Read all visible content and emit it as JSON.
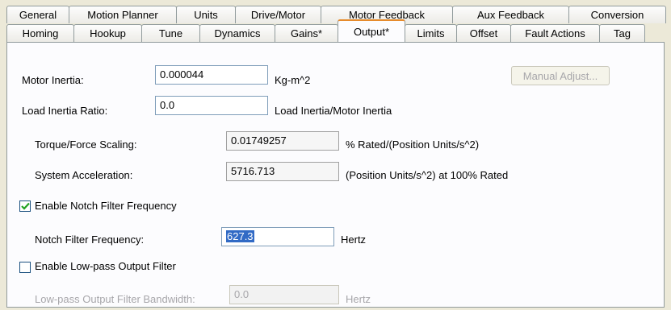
{
  "tabs_back": [
    "General",
    "Motion Planner",
    "Units",
    "Drive/Motor",
    "Motor Feedback",
    "Aux Feedback",
    "Conversion"
  ],
  "tabs_front": [
    "Homing",
    "Hookup",
    "Tune",
    "Dynamics",
    "Gains*",
    "Output*",
    "Limits",
    "Offset",
    "Fault Actions",
    "Tag"
  ],
  "active_tab": "Output*",
  "motor_inertia": {
    "label": "Motor Inertia:",
    "value": "0.000044",
    "unit": "Kg-m^2"
  },
  "manual_adjust_label": "Manual Adjust...",
  "load_inertia": {
    "label": "Load Inertia Ratio:",
    "value": "0.0",
    "unit": "Load Inertia/Motor Inertia"
  },
  "torque_scaling": {
    "label": "Torque/Force Scaling:",
    "value": "0.01749257",
    "unit": "% Rated/(Position Units/s^2)"
  },
  "system_accel": {
    "label": "System Acceleration:",
    "value": "5716.713",
    "unit": "(Position Units/s^2) at 100% Rated"
  },
  "notch_enable": {
    "label": "Enable Notch Filter Frequency",
    "checked": true
  },
  "notch_freq": {
    "label": "Notch Filter Frequency:",
    "value": "627.3",
    "unit": "Hertz"
  },
  "lowpass_enable": {
    "label": "Enable Low-pass Output Filter",
    "checked": false
  },
  "lowpass_bw": {
    "label": "Low-pass Output Filter Bandwidth:",
    "value": "0.0",
    "unit": "Hertz"
  }
}
